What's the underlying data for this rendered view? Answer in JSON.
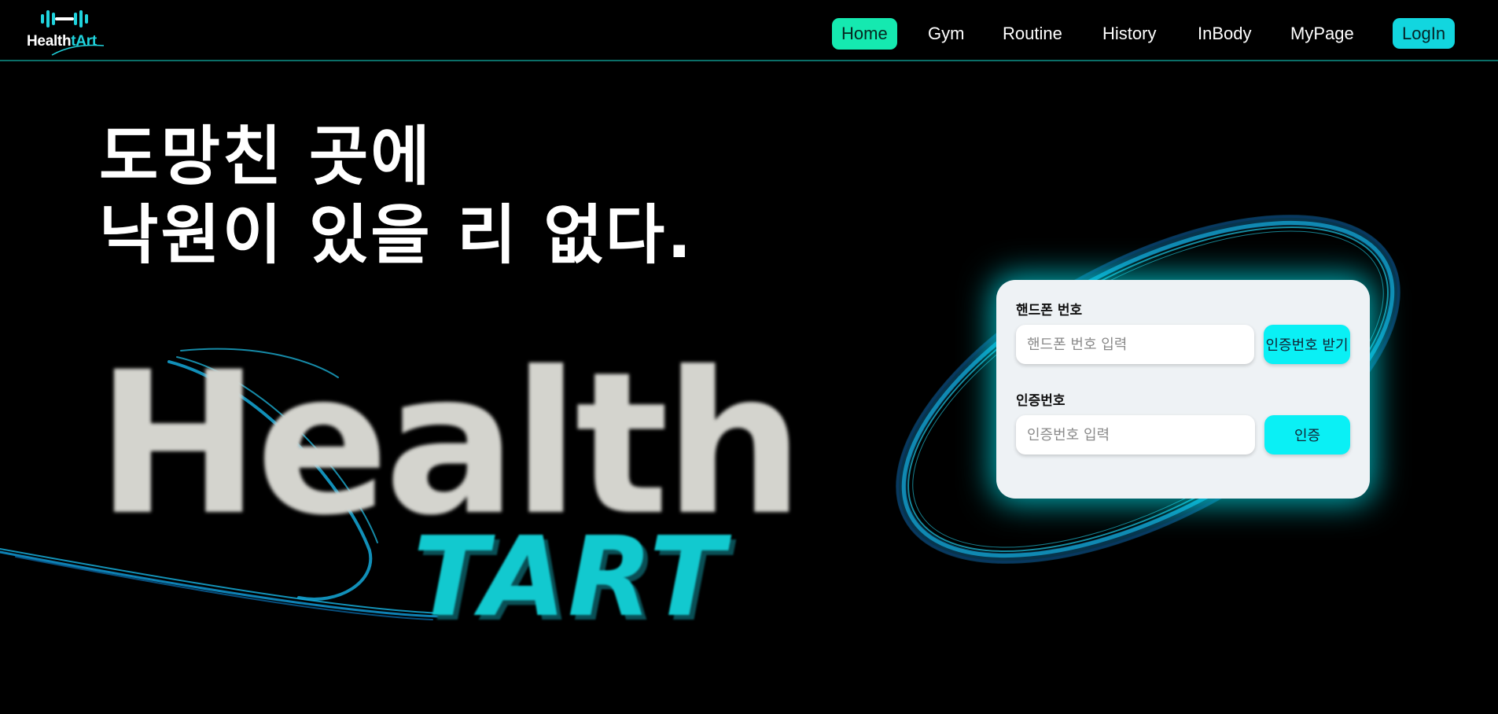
{
  "header": {
    "logo": {
      "text_white": "Health",
      "text_cyan": "tArt",
      "icon": "dumbbell-icon"
    },
    "nav": [
      {
        "label": "Home",
        "active": true
      },
      {
        "label": "Gym",
        "active": false
      },
      {
        "label": "Routine",
        "active": false
      },
      {
        "label": "History",
        "active": false
      },
      {
        "label": "InBody",
        "active": false
      },
      {
        "label": "MyPage",
        "active": false
      }
    ],
    "login_label": "LogIn"
  },
  "hero": {
    "headline_line1": "도망친 곳에",
    "headline_line2": "낙원이 있을 리 없다.",
    "big_logo_top": "Health",
    "big_logo_bottom": "TART"
  },
  "auth": {
    "phone_label": "핸드폰 번호",
    "phone_placeholder": "핸드폰 번호 입력",
    "phone_value": "",
    "request_code_label": "인증번호 받기",
    "code_label": "인증번호",
    "code_placeholder": "인증번호 입력",
    "code_value": "",
    "verify_label": "인증"
  },
  "colors": {
    "background": "#000000",
    "accent_cyan": "#12d6df",
    "active_green": "#15e9b0",
    "card_bg": "#eef2f5",
    "header_border": "#0b6f68"
  }
}
